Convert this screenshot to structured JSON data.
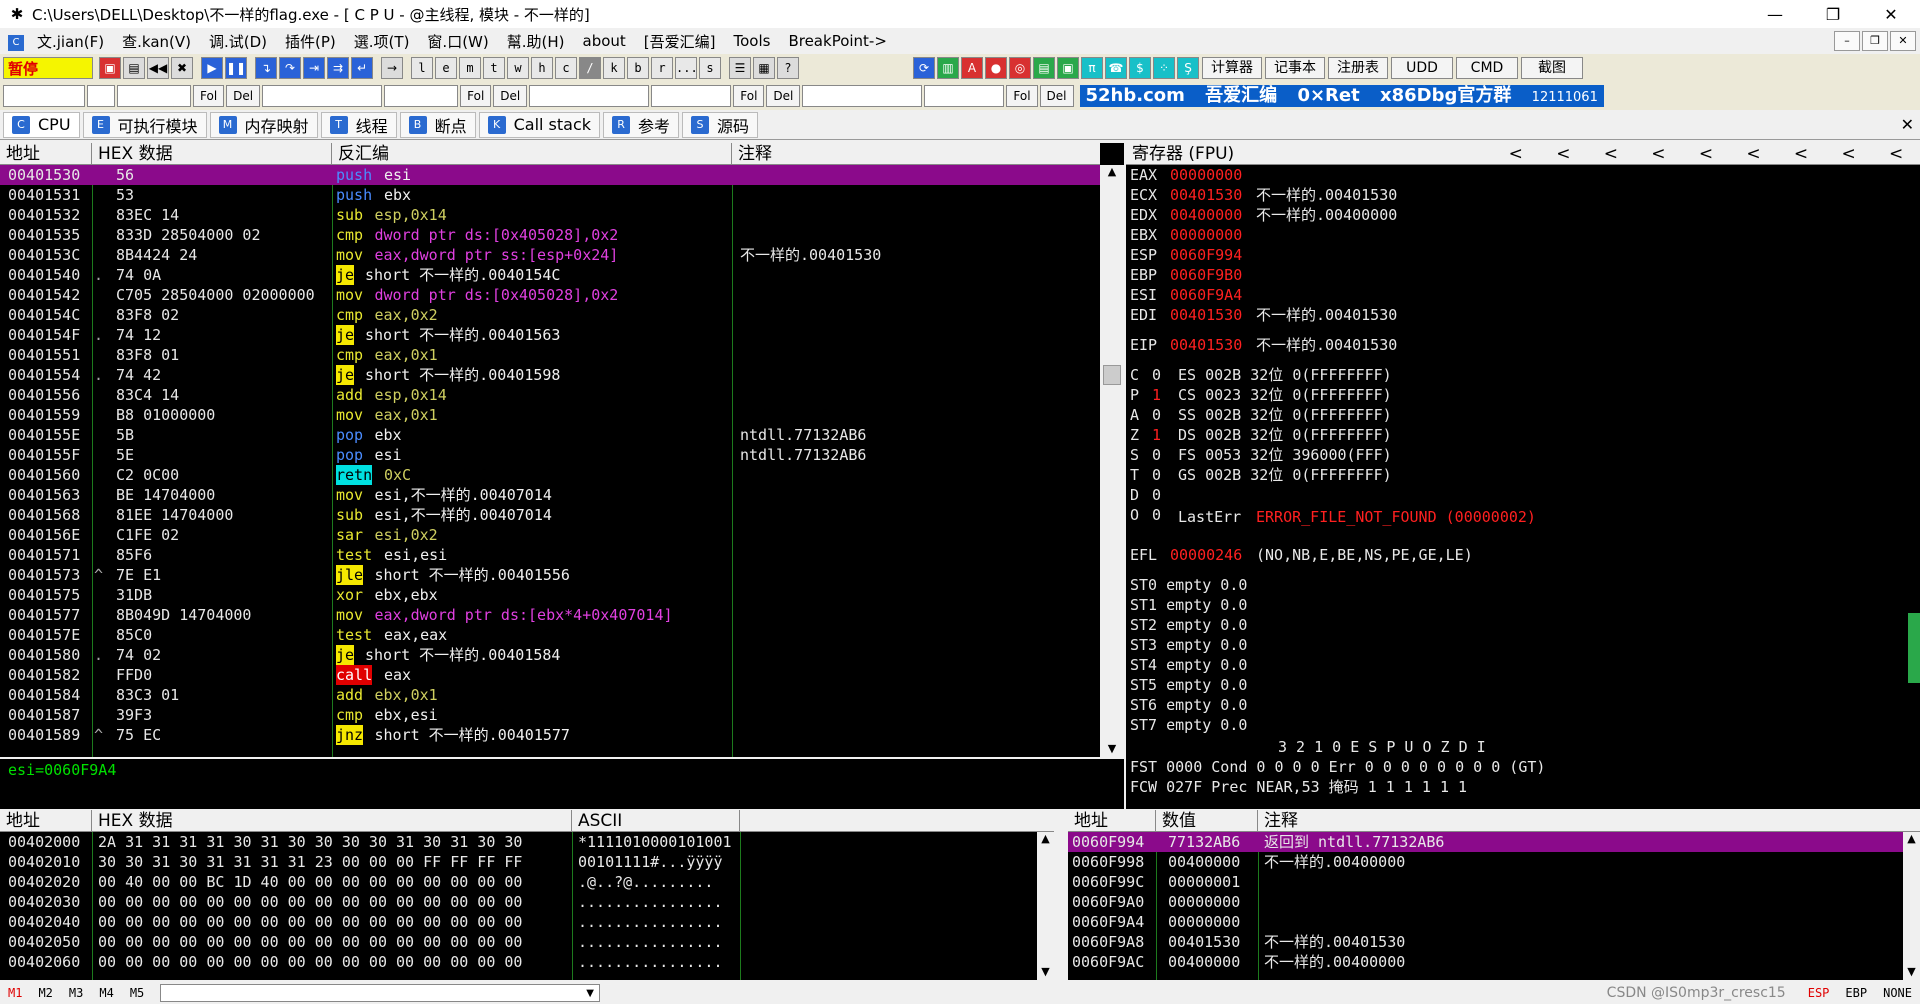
{
  "window": {
    "title": "C:\\Users\\DELL\\Desktop\\不一样的flag.exe - [ C P U  - @主线程, 模块 - 不一样的]",
    "minimize": "—",
    "maximize": "❐",
    "close": "✕"
  },
  "menu": {
    "items": [
      "文.jian(F)",
      "查.kan(V)",
      "调.试(D)",
      "插件(P)",
      "選.项(T)",
      "窗.口(W)",
      "幫.助(H)",
      "about",
      "[吾爱汇编]",
      "Tools",
      "BreakPoint->"
    ],
    "mdi": [
      "–",
      "❐",
      "✕"
    ]
  },
  "toolbar": {
    "pause": "暂停",
    "letters": [
      "l",
      "e",
      "m",
      "t",
      "w",
      "h",
      "c",
      "/",
      "k",
      "b",
      "r",
      "...",
      "s"
    ],
    "text_buttons": [
      "计算器",
      "记事本",
      "注册表",
      "UDD",
      "CMD",
      "截图"
    ]
  },
  "cmdbar": {
    "fol": "Fol",
    "del": "Del",
    "banner": [
      "52hb.com",
      "吾爱汇编",
      "0×Ret",
      "x86Dbg官方群",
      "12111061"
    ]
  },
  "tabs": [
    {
      "label": "CPU",
      "icon": "C"
    },
    {
      "label": "可执行模块",
      "icon": "E"
    },
    {
      "label": "内存映射",
      "icon": "M"
    },
    {
      "label": "线程",
      "icon": "T"
    },
    {
      "label": "断点",
      "icon": "B"
    },
    {
      "label": "Call stack",
      "icon": "K"
    },
    {
      "label": "参考",
      "icon": "R"
    },
    {
      "label": "源码",
      "icon": "S"
    }
  ],
  "tab_close": "✕",
  "disasm": {
    "headers": [
      "地址",
      "HEX 数据",
      "反汇编",
      "注释"
    ],
    "rows": [
      {
        "addr": "00401530",
        "mark": "",
        "hex": "56",
        "mn": "push",
        "op": "esi",
        "mk": "push",
        "ok": "reg",
        "cmt": "",
        "sel": true
      },
      {
        "addr": "00401531",
        "mark": "",
        "hex": "53",
        "mn": "push",
        "op": "ebx",
        "mk": "push",
        "ok": "reg",
        "cmt": ""
      },
      {
        "addr": "00401532",
        "mark": "",
        "hex": "83EC 14",
        "mn": "sub",
        "op": "esp,0x14",
        "mk": "sub",
        "ok": "num",
        "cmt": ""
      },
      {
        "addr": "00401535",
        "mark": "",
        "hex": "833D 28504000 02",
        "mn": "cmp",
        "op": "dword ptr ds:[0x405028],0x2",
        "mk": "cmp",
        "ok": "mem",
        "cmt": ""
      },
      {
        "addr": "0040153C",
        "mark": "",
        "hex": "8B4424 24",
        "mn": "mov",
        "op": "eax,dword ptr ss:[esp+0x24]",
        "mk": "mov",
        "ok": "mem",
        "cmt": "不一样的.00401530"
      },
      {
        "addr": "00401540",
        "mark": ".",
        "hex": "74 0A",
        "mn": "je",
        "op": "short 不一样的.0040154C",
        "mk": "jcc",
        "ok": "plain",
        "cmt": ""
      },
      {
        "addr": "00401542",
        "mark": "",
        "hex": "C705 28504000 02000000",
        "mn": "mov",
        "op": "dword ptr ds:[0x405028],0x2",
        "mk": "mov",
        "ok": "mem",
        "cmt": ""
      },
      {
        "addr": "0040154C",
        "mark": "",
        "hex": "83F8 02",
        "mn": "cmp",
        "op": "eax,0x2",
        "mk": "cmp",
        "ok": "num",
        "cmt": ""
      },
      {
        "addr": "0040154F",
        "mark": ".",
        "hex": "74 12",
        "mn": "je",
        "op": "short 不一样的.00401563",
        "mk": "jcc",
        "ok": "plain",
        "cmt": ""
      },
      {
        "addr": "00401551",
        "mark": "",
        "hex": "83F8 01",
        "mn": "cmp",
        "op": "eax,0x1",
        "mk": "cmp",
        "ok": "num",
        "cmt": ""
      },
      {
        "addr": "00401554",
        "mark": ".",
        "hex": "74 42",
        "mn": "je",
        "op": "short 不一样的.00401598",
        "mk": "jcc",
        "ok": "plain",
        "cmt": ""
      },
      {
        "addr": "00401556",
        "mark": "",
        "hex": "83C4 14",
        "mn": "add",
        "op": "esp,0x14",
        "mk": "gen",
        "ok": "num",
        "cmt": ""
      },
      {
        "addr": "00401559",
        "mark": "",
        "hex": "B8 01000000",
        "mn": "mov",
        "op": "eax,0x1",
        "mk": "mov",
        "ok": "num",
        "cmt": ""
      },
      {
        "addr": "0040155E",
        "mark": "",
        "hex": "5B",
        "mn": "pop",
        "op": "ebx",
        "mk": "push",
        "ok": "reg",
        "cmt": "ntdll.77132AB6"
      },
      {
        "addr": "0040155F",
        "mark": "",
        "hex": "5E",
        "mn": "pop",
        "op": "esi",
        "mk": "push",
        "ok": "reg",
        "cmt": "ntdll.77132AB6"
      },
      {
        "addr": "00401560",
        "mark": "",
        "hex": "C2 0C00",
        "mn": "retn",
        "op": "0xC",
        "mk": "ret",
        "ok": "num",
        "cmt": ""
      },
      {
        "addr": "00401563",
        "mark": "",
        "hex": "BE 14704000",
        "mn": "mov",
        "op": "esi,不一样的.00407014",
        "mk": "mov",
        "ok": "plain",
        "cmt": ""
      },
      {
        "addr": "00401568",
        "mark": "",
        "hex": "81EE 14704000",
        "mn": "sub",
        "op": "esi,不一样的.00407014",
        "mk": "sub",
        "ok": "plain",
        "cmt": ""
      },
      {
        "addr": "0040156E",
        "mark": "",
        "hex": "C1FE 02",
        "mn": "sar",
        "op": "esi,0x2",
        "mk": "gen",
        "ok": "num",
        "cmt": ""
      },
      {
        "addr": "00401571",
        "mark": "",
        "hex": "85F6",
        "mn": "test",
        "op": "esi,esi",
        "mk": "test",
        "ok": "reg",
        "cmt": ""
      },
      {
        "addr": "00401573",
        "mark": "^",
        "hex": "7E E1",
        "mn": "jle",
        "op": "short 不一样的.00401556",
        "mk": "jcc",
        "ok": "plain",
        "cmt": ""
      },
      {
        "addr": "00401575",
        "mark": "",
        "hex": "31DB",
        "mn": "xor",
        "op": "ebx,ebx",
        "mk": "gen",
        "ok": "reg",
        "cmt": ""
      },
      {
        "addr": "00401577",
        "mark": "",
        "hex": "8B049D 14704000",
        "mn": "mov",
        "op": "eax,dword ptr ds:[ebx*4+0x407014]",
        "mk": "mov",
        "ok": "mem",
        "cmt": ""
      },
      {
        "addr": "0040157E",
        "mark": "",
        "hex": "85C0",
        "mn": "test",
        "op": "eax,eax",
        "mk": "test",
        "ok": "reg",
        "cmt": ""
      },
      {
        "addr": "00401580",
        "mark": ".",
        "hex": "74 02",
        "mn": "je",
        "op": "short 不一样的.00401584",
        "mk": "jcc",
        "ok": "plain",
        "cmt": ""
      },
      {
        "addr": "00401582",
        "mark": "",
        "hex": "FFD0",
        "mn": "call",
        "op": "eax",
        "mk": "call",
        "ok": "reg",
        "cmt": ""
      },
      {
        "addr": "00401584",
        "mark": "",
        "hex": "83C3 01",
        "mn": "add",
        "op": "ebx,0x1",
        "mk": "gen",
        "ok": "num",
        "cmt": ""
      },
      {
        "addr": "00401587",
        "mark": "",
        "hex": "39F3",
        "mn": "cmp",
        "op": "ebx,esi",
        "mk": "cmp",
        "ok": "reg",
        "cmt": ""
      },
      {
        "addr": "00401589",
        "mark": "^",
        "hex": "75 EC",
        "mn": "jnz",
        "op": "short 不一样的.00401577",
        "mk": "jcc",
        "ok": "plain",
        "cmt": ""
      }
    ]
  },
  "info_line": "esi=0060F9A4",
  "registers": {
    "header": "寄存器 (FPU)",
    "arrows": [
      "<",
      "<",
      "<",
      "<",
      "<",
      "<",
      "<",
      "<",
      "<"
    ],
    "gp": [
      {
        "name": "EAX",
        "val": "00000000",
        "desc": ""
      },
      {
        "name": "ECX",
        "val": "00401530",
        "desc": "不一样的.00401530"
      },
      {
        "name": "EDX",
        "val": "00400000",
        "desc": "不一样的.00400000"
      },
      {
        "name": "EBX",
        "val": "00000000",
        "desc": ""
      },
      {
        "name": "ESP",
        "val": "0060F994",
        "desc": ""
      },
      {
        "name": "EBP",
        "val": "0060F9B0",
        "desc": ""
      },
      {
        "name": "ESI",
        "val": "0060F9A4",
        "desc": ""
      },
      {
        "name": "EDI",
        "val": "00401530",
        "desc": "不一样的.00401530"
      }
    ],
    "eip": {
      "name": "EIP",
      "val": "00401530",
      "desc": "不一样的.00401530"
    },
    "flags": [
      {
        "f": "C",
        "v": "0",
        "seg": "ES 002B 32位 0(FFFFFFFF)"
      },
      {
        "f": "P",
        "v": "1",
        "seg": "CS 0023 32位 0(FFFFFFFF)"
      },
      {
        "f": "A",
        "v": "0",
        "seg": "SS 002B 32位 0(FFFFFFFF)"
      },
      {
        "f": "Z",
        "v": "1",
        "seg": "DS 002B 32位 0(FFFFFFFF)"
      },
      {
        "f": "S",
        "v": "0",
        "seg": "FS 0053 32位 396000(FFF)"
      },
      {
        "f": "T",
        "v": "0",
        "seg": "GS 002B 32位 0(FFFFFFFF)"
      },
      {
        "f": "D",
        "v": "0",
        "seg": ""
      },
      {
        "f": "O",
        "v": "0",
        "seg": ""
      }
    ],
    "lasterr_label": "LastErr",
    "lasterr_val": "ERROR_FILE_NOT_FOUND (00000002)",
    "efl_label": "EFL",
    "efl_val": "00000246",
    "efl_desc": "(NO,NB,E,BE,NS,PE,GE,LE)",
    "st": [
      "ST0 empty 0.0",
      "ST1 empty 0.0",
      "ST2 empty 0.0",
      "ST3 empty 0.0",
      "ST4 empty 0.0",
      "ST5 empty 0.0",
      "ST6 empty 0.0",
      "ST7 empty 0.0"
    ],
    "fpu_hdr": "3 2 1 0      E S P U O Z D I",
    "fst": "FST 0000  Cond 0 0 0 0  Err 0 0 0 0 0 0 0 0  (GT)",
    "fcw": "FCW 027F  Prec NEAR,53  掩码    1 1 1 1 1 1"
  },
  "dump": {
    "headers": [
      "地址",
      "HEX 数据",
      "ASCII"
    ],
    "rows": [
      {
        "addr": "00402000",
        "hex": "2A 31 31 31 31 30 31 30 30 30 30 31 30 31 30 30",
        "ascii": "*1111010000101001"
      },
      {
        "addr": "00402010",
        "hex": "30 30 31 30 31 31 31 31 23 00 00 00 FF FF FF FF",
        "ascii": "00101111#...ÿÿÿÿ"
      },
      {
        "addr": "00402020",
        "hex": "00 40 00 00 BC 1D 40 00 00 00 00 00 00 00 00 00",
        "ascii": ".@..?@........."
      },
      {
        "addr": "00402030",
        "hex": "00 00 00 00 00 00 00 00 00 00 00 00 00 00 00 00",
        "ascii": "................"
      },
      {
        "addr": "00402040",
        "hex": "00 00 00 00 00 00 00 00 00 00 00 00 00 00 00 00",
        "ascii": "................"
      },
      {
        "addr": "00402050",
        "hex": "00 00 00 00 00 00 00 00 00 00 00 00 00 00 00 00",
        "ascii": "................"
      },
      {
        "addr": "00402060",
        "hex": "00 00 00 00 00 00 00 00 00 00 00 00 00 00 00 00",
        "ascii": "................"
      }
    ]
  },
  "stack": {
    "headers": [
      "地址",
      "数值",
      "注释"
    ],
    "rows": [
      {
        "addr": "0060F994",
        "val": "77132AB6",
        "cmt": "返回到 ntdll.77132AB6",
        "sel": true
      },
      {
        "addr": "0060F998",
        "val": "00400000",
        "cmt": "不一样的.00400000"
      },
      {
        "addr": "0060F99C",
        "val": "00000001",
        "cmt": ""
      },
      {
        "addr": "0060F9A0",
        "val": "00000000",
        "cmt": ""
      },
      {
        "addr": "0060F9A4",
        "val": "00000000",
        "cmt": ""
      },
      {
        "addr": "0060F9A8",
        "val": "00401530",
        "cmt": "不一样的.00401530"
      },
      {
        "addr": "0060F9AC",
        "val": "00400000",
        "cmt": "不一样的.00400000"
      }
    ]
  },
  "status": {
    "modes": [
      "M1",
      "M2",
      "M3",
      "M4",
      "M5"
    ],
    "right": [
      "ESP",
      "EBP",
      "NONE"
    ],
    "watermark": "CSDN @IS0mp3r_cresc15"
  }
}
